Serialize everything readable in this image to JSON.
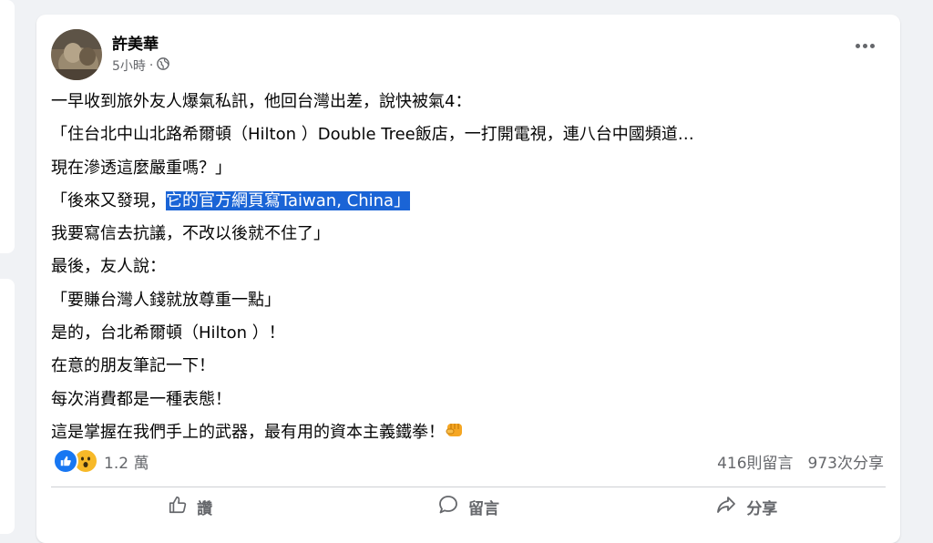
{
  "post": {
    "author": "許美華",
    "time": "5小時",
    "separator": "·",
    "lines": [
      "一早收到旅外友人爆氣私訊，他回台灣出差，說快被氣4：",
      "「住台北中山北路希爾頓（Hilton ）Double Tree飯店，一打開電視，連八台中國頻道…",
      "現在滲透這麼嚴重嗎？」",
      "",
      "我要寫信去抗議，不改以後就不住了」",
      "最後，友人說：",
      "「要賺台灣人錢就放尊重一點」",
      "是的，台北希爾頓（Hilton ）！",
      "在意的朋友筆記一下！",
      "每次消費都是一種表態！",
      "這是掌握在我們手上的武器，最有用的資本主義鐵拳！"
    ],
    "line4_prefix": "「後來又發現，",
    "line4_highlight": "它的官方網頁寫Taiwan, China」"
  },
  "reactions": {
    "count": "1.2 萬",
    "types": [
      "like",
      "wow"
    ]
  },
  "stats": {
    "comments": "416則留言",
    "shares": "973次分享"
  },
  "actions": {
    "like": "讚",
    "comment": "留言",
    "share": "分享"
  },
  "colors": {
    "highlight": "#1a64d6",
    "like": "#1877f2",
    "wow": "#f7b928",
    "fist": "#f5a623"
  },
  "icons": {
    "privacy": "globe-icon",
    "more": "more-options-icon",
    "like": "thumbs-up-icon",
    "comment": "comment-bubble-icon",
    "share": "share-arrow-icon",
    "emoji": "fist-emoji-icon"
  }
}
